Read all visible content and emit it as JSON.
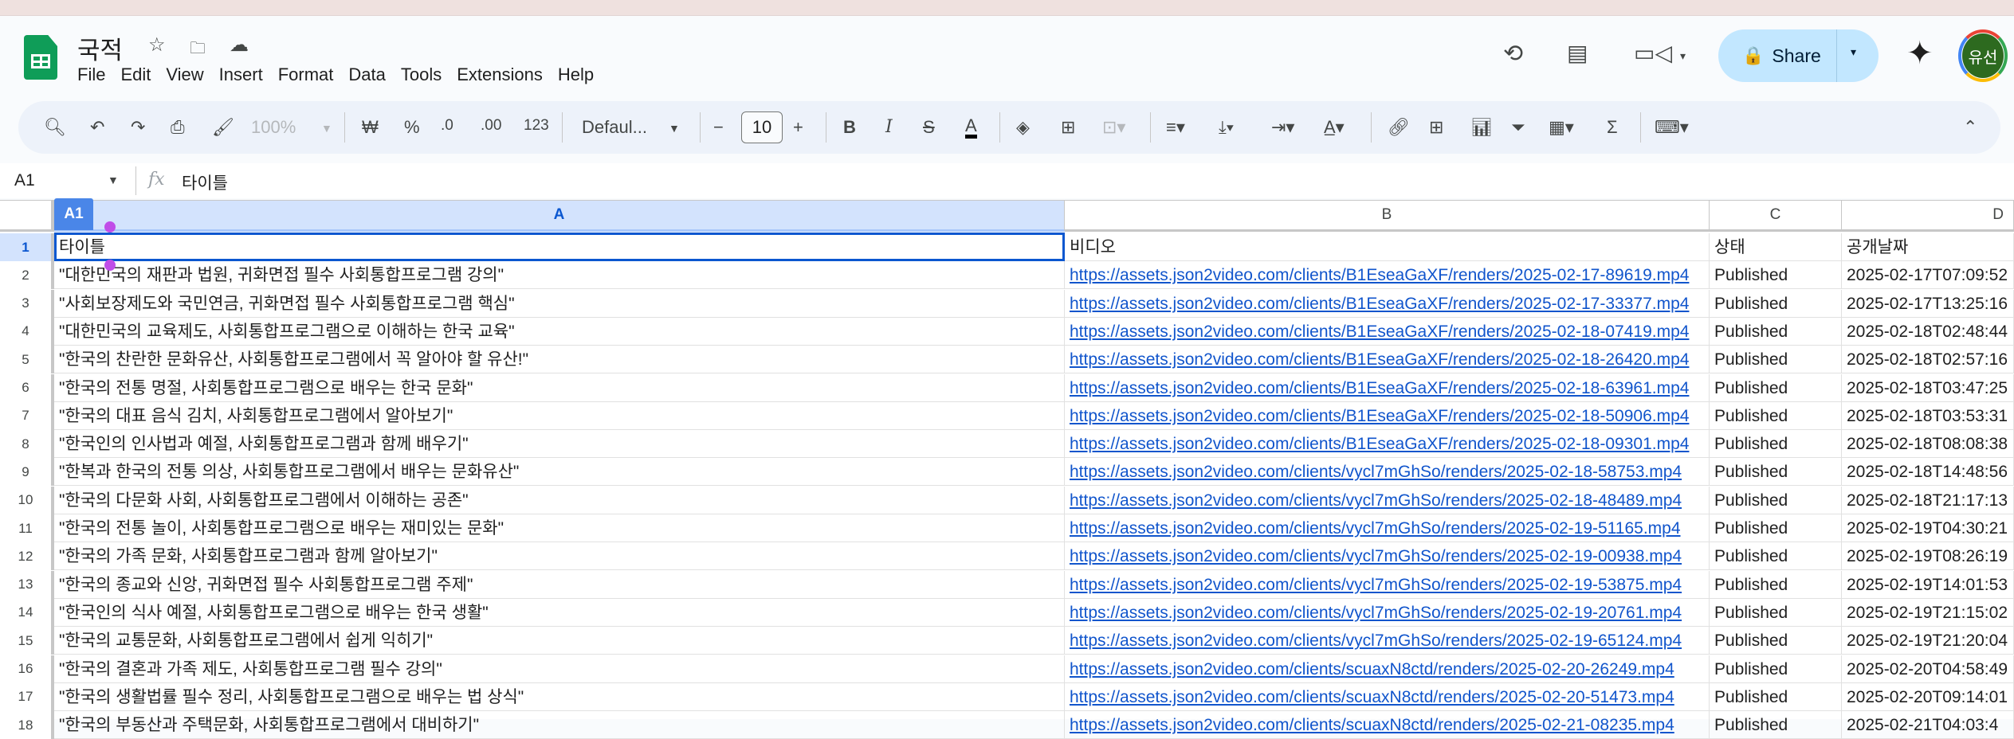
{
  "app": {
    "title": "국적",
    "menu": [
      "File",
      "Edit",
      "View",
      "Insert",
      "Format",
      "Data",
      "Tools",
      "Extensions",
      "Help"
    ],
    "share_label": "Share",
    "avatar_text": "유선"
  },
  "toolbar": {
    "zoom": "100%",
    "currency": "₩",
    "percent": "%",
    "dec_decrease": ".0",
    "dec_increase": ".00",
    "number_format": "123",
    "font": "Defaul...",
    "font_size": "10",
    "bold": "B",
    "italic": "I",
    "minus": "−",
    "plus": "+",
    "sigma": "Σ"
  },
  "formula_bar": {
    "name_box": "A1",
    "fx": "fx",
    "value": "타이틀"
  },
  "columns": [
    "A",
    "B",
    "C",
    "D"
  ],
  "selected_cell": "A1",
  "rows": [
    {
      "n": "1",
      "a": "타이틀",
      "b": "비디오",
      "c": "상태",
      "d": "공개날짜",
      "header": true
    },
    {
      "n": "2",
      "a": "\"대한민국의 재판과 법원, 귀화면접 필수 사회통합프로그램 강의\"",
      "b": "https://assets.json2video.com/clients/B1EseaGaXF/renders/2025-02-17-89619.mp4",
      "c": "Published",
      "d": "2025-02-17T07:09:52"
    },
    {
      "n": "3",
      "a": "\"사회보장제도와 국민연금, 귀화면접 필수 사회통합프로그램 핵심\"",
      "b": "https://assets.json2video.com/clients/B1EseaGaXF/renders/2025-02-17-33377.mp4",
      "c": "Published",
      "d": "2025-02-17T13:25:16"
    },
    {
      "n": "4",
      "a": "\"대한민국의 교육제도, 사회통합프로그램으로 이해하는 한국 교육\"",
      "b": "https://assets.json2video.com/clients/B1EseaGaXF/renders/2025-02-18-07419.mp4",
      "c": "Published",
      "d": "2025-02-18T02:48:44"
    },
    {
      "n": "5",
      "a": "\"한국의 찬란한 문화유산, 사회통합프로그램에서 꼭 알아야 할 유산!\"",
      "b": "https://assets.json2video.com/clients/B1EseaGaXF/renders/2025-02-18-26420.mp4",
      "c": "Published",
      "d": "2025-02-18T02:57:16"
    },
    {
      "n": "6",
      "a": "\"한국의 전통 명절, 사회통합프로그램으로 배우는 한국 문화\"",
      "b": "https://assets.json2video.com/clients/B1EseaGaXF/renders/2025-02-18-63961.mp4",
      "c": "Published",
      "d": "2025-02-18T03:47:25"
    },
    {
      "n": "7",
      "a": "\"한국의 대표 음식 김치, 사회통합프로그램에서 알아보기\"",
      "b": "https://assets.json2video.com/clients/B1EseaGaXF/renders/2025-02-18-50906.mp4",
      "c": "Published",
      "d": "2025-02-18T03:53:31"
    },
    {
      "n": "8",
      "a": "\"한국인의 인사법과 예절, 사회통합프로그램과 함께 배우기\"",
      "b": "https://assets.json2video.com/clients/B1EseaGaXF/renders/2025-02-18-09301.mp4",
      "c": "Published",
      "d": "2025-02-18T08:08:38"
    },
    {
      "n": "9",
      "a": "\"한복과 한국의 전통 의상, 사회통합프로그램에서 배우는 문화유산\"",
      "b": "https://assets.json2video.com/clients/vycl7mGhSo/renders/2025-02-18-58753.mp4",
      "c": "Published",
      "d": "2025-02-18T14:48:56"
    },
    {
      "n": "10",
      "a": "\"한국의 다문화 사회, 사회통합프로그램에서 이해하는 공존\"",
      "b": "https://assets.json2video.com/clients/vycl7mGhSo/renders/2025-02-18-48489.mp4",
      "c": "Published",
      "d": "2025-02-18T21:17:13"
    },
    {
      "n": "11",
      "a": "\"한국의 전통 놀이, 사회통합프로그램으로 배우는 재미있는 문화\"",
      "b": "https://assets.json2video.com/clients/vycl7mGhSo/renders/2025-02-19-51165.mp4",
      "c": "Published",
      "d": "2025-02-19T04:30:21"
    },
    {
      "n": "12",
      "a": "\"한국의 가족 문화, 사회통합프로그램과 함께 알아보기\"",
      "b": "https://assets.json2video.com/clients/vycl7mGhSo/renders/2025-02-19-00938.mp4",
      "c": "Published",
      "d": "2025-02-19T08:26:19"
    },
    {
      "n": "13",
      "a": "\"한국의 종교와 신앙, 귀화면접 필수 사회통합프로그램 주제\"",
      "b": "https://assets.json2video.com/clients/vycl7mGhSo/renders/2025-02-19-53875.mp4",
      "c": "Published",
      "d": "2025-02-19T14:01:53"
    },
    {
      "n": "14",
      "a": "\"한국인의 식사 예절, 사회통합프로그램으로 배우는 한국 생활\"",
      "b": "https://assets.json2video.com/clients/vycl7mGhSo/renders/2025-02-19-20761.mp4",
      "c": "Published",
      "d": "2025-02-19T21:15:02"
    },
    {
      "n": "15",
      "a": "\"한국의 교통문화, 사회통합프로그램에서 쉽게 익히기\"",
      "b": "https://assets.json2video.com/clients/vycl7mGhSo/renders/2025-02-19-65124.mp4",
      "c": "Published",
      "d": "2025-02-19T21:20:04"
    },
    {
      "n": "16",
      "a": "\"한국의 결혼과 가족 제도, 사회통합프로그램 필수 강의\"",
      "b": "https://assets.json2video.com/clients/scuaxN8ctd/renders/2025-02-20-26249.mp4",
      "c": "Published",
      "d": "2025-02-20T04:58:49"
    },
    {
      "n": "17",
      "a": "\"한국의 생활법률 필수 정리, 사회통합프로그램으로 배우는 법 상식\"",
      "b": "https://assets.json2video.com/clients/scuaxN8ctd/renders/2025-02-20-51473.mp4",
      "c": "Published",
      "d": "2025-02-20T09:14:01"
    },
    {
      "n": "18",
      "a": "\"한국의 부동산과 주택문화, 사회통합프로그램에서 대비하기\"",
      "b": "https://assets.json2video.com/clients/scuaxN8ctd/renders/2025-02-21-08235.mp4",
      "c": "Published",
      "d": "2025-02-21T04:03:4"
    }
  ],
  "colors": {
    "accent": "#0b57d0",
    "share_bg": "#c2e7ff",
    "sheets_green": "#0f9d58",
    "link": "#1155cc"
  }
}
